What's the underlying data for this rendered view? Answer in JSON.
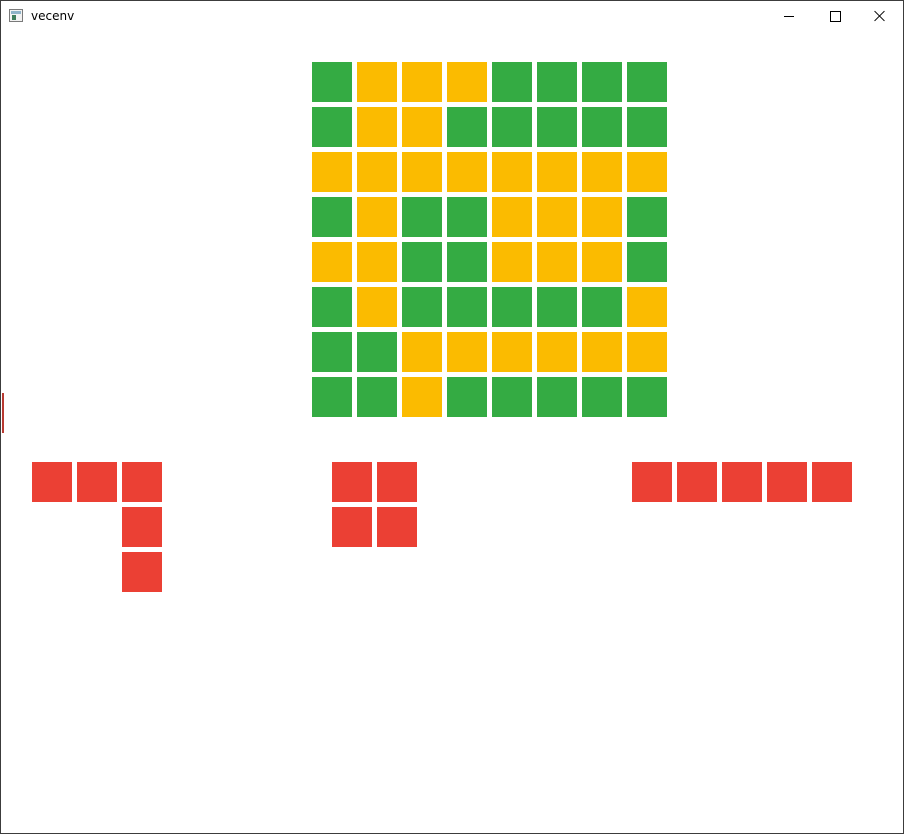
{
  "window": {
    "title": "vecenv",
    "controls": [
      "minimize",
      "maximize",
      "close"
    ]
  },
  "colors": {
    "filled": "#34ab43",
    "empty": "#fbbb00",
    "piece": "#eb4034"
  },
  "board": {
    "rows": 8,
    "cols": 8,
    "cells": [
      [
        1,
        0,
        0,
        0,
        1,
        1,
        1,
        1
      ],
      [
        1,
        0,
        0,
        1,
        1,
        1,
        1,
        1
      ],
      [
        0,
        0,
        0,
        0,
        0,
        0,
        0,
        0
      ],
      [
        1,
        0,
        1,
        1,
        0,
        0,
        0,
        1
      ],
      [
        0,
        0,
        1,
        1,
        0,
        0,
        0,
        1
      ],
      [
        1,
        0,
        1,
        1,
        1,
        1,
        1,
        0
      ],
      [
        1,
        1,
        0,
        0,
        0,
        0,
        0,
        0
      ],
      [
        1,
        1,
        0,
        1,
        1,
        1,
        1,
        1
      ]
    ]
  },
  "pieces": [
    {
      "name": "corner-piece",
      "cells": [
        [
          1,
          1,
          1
        ],
        [
          0,
          0,
          1
        ],
        [
          0,
          0,
          1
        ]
      ]
    },
    {
      "name": "square-piece",
      "cells": [
        [
          1,
          1
        ],
        [
          1,
          1
        ]
      ]
    },
    {
      "name": "line-piece",
      "cells": [
        [
          1,
          1,
          1,
          1,
          1
        ]
      ]
    }
  ]
}
